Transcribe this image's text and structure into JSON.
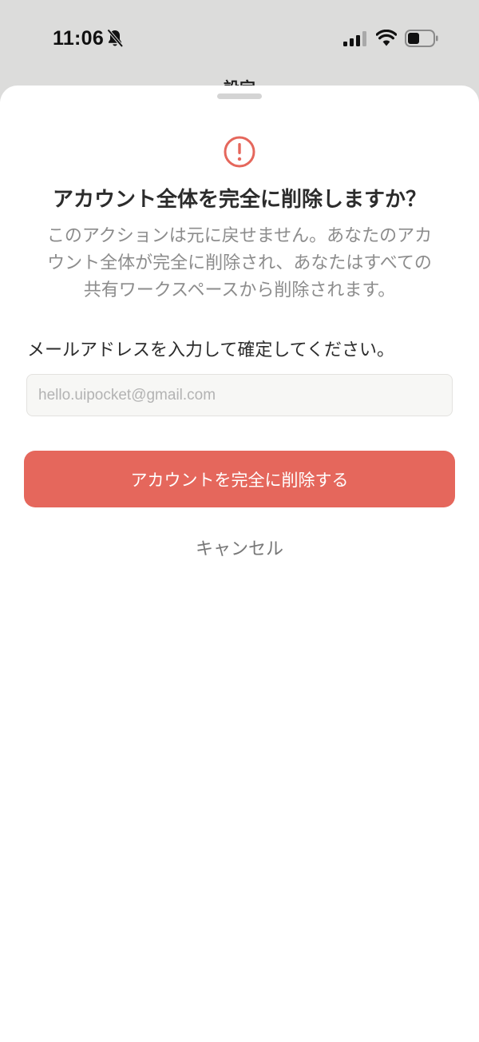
{
  "status_bar": {
    "time": "11:06",
    "icons": [
      "bell-slash-icon",
      "cellular-signal-icon",
      "wifi-icon",
      "battery-icon"
    ]
  },
  "background_screen": {
    "title": "設定"
  },
  "dialog": {
    "icon": "alert-circle-icon",
    "title": "アカウント全体を完全に削除しますか？",
    "description": "このアクションは元に戻せません。あなたのアカウント全体が完全に削除され、あなたはすべての共有ワークスペースから削除されます。",
    "email_label": "メールアドレスを入力して確定してください。",
    "email_input": {
      "value": "",
      "placeholder": "hello.uipocket@gmail.com"
    },
    "delete_button_label": "アカウントを完全に削除する",
    "cancel_button_label": "キャンセル"
  },
  "colors": {
    "accent_red": "#e5675c",
    "sheet_background": "#ffffff",
    "backdrop": "#dcdcdb"
  }
}
